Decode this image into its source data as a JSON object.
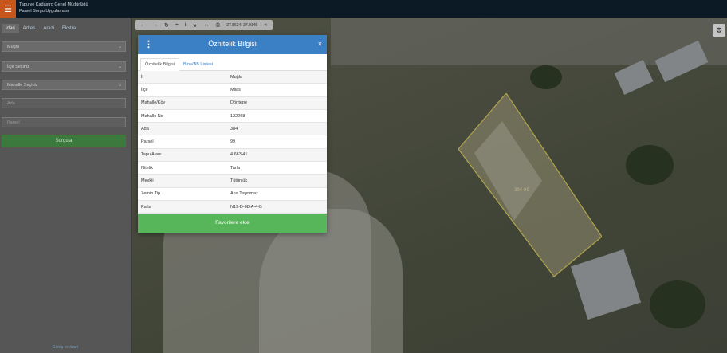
{
  "header": {
    "title_line1": "Tapu ve Kadastro Genel Müdürlüğü",
    "title_line2": "Parsel Sorgu Uygulaması"
  },
  "sidebar": {
    "tabs": [
      "İdari",
      "Adres",
      "Arazi",
      "Ekstra"
    ],
    "il_select": "Muğla",
    "ilce_select": "İlçe Seçiniz",
    "mahalle_select": "Mahalle Seçiniz",
    "ada_placeholder": "Ada",
    "parsel_placeholder": "Parsel",
    "query_button": "Sorgula",
    "footer": "Görüş ve öneri"
  },
  "map": {
    "coords": "27.5634; 37.9145",
    "parcel_label": "384-99"
  },
  "modal": {
    "title": "Öznitelik Bilgisi",
    "tabs": [
      "Öznitelik Bilgisi",
      "Bina/BB Listesi"
    ],
    "rows": [
      {
        "key": "İl",
        "value": "Muğla"
      },
      {
        "key": "İlçe",
        "value": "Milas"
      },
      {
        "key": "Mahalle/Köy",
        "value": "Dörttepe"
      },
      {
        "key": "Mahalle No",
        "value": "122268"
      },
      {
        "key": "Ada",
        "value": "384"
      },
      {
        "key": "Parsel",
        "value": "99"
      },
      {
        "key": "Tapu Alanı",
        "value": "4.663,41"
      },
      {
        "key": "Nitelik",
        "value": "Tarla"
      },
      {
        "key": "Mevkii",
        "value": "Tütünlük"
      },
      {
        "key": "Zemin Tip",
        "value": "Ana Taşınmaz"
      },
      {
        "key": "Pafta",
        "value": "N19-D-08-A-4-B"
      }
    ],
    "favorite_button": "Favorilere ekle"
  }
}
